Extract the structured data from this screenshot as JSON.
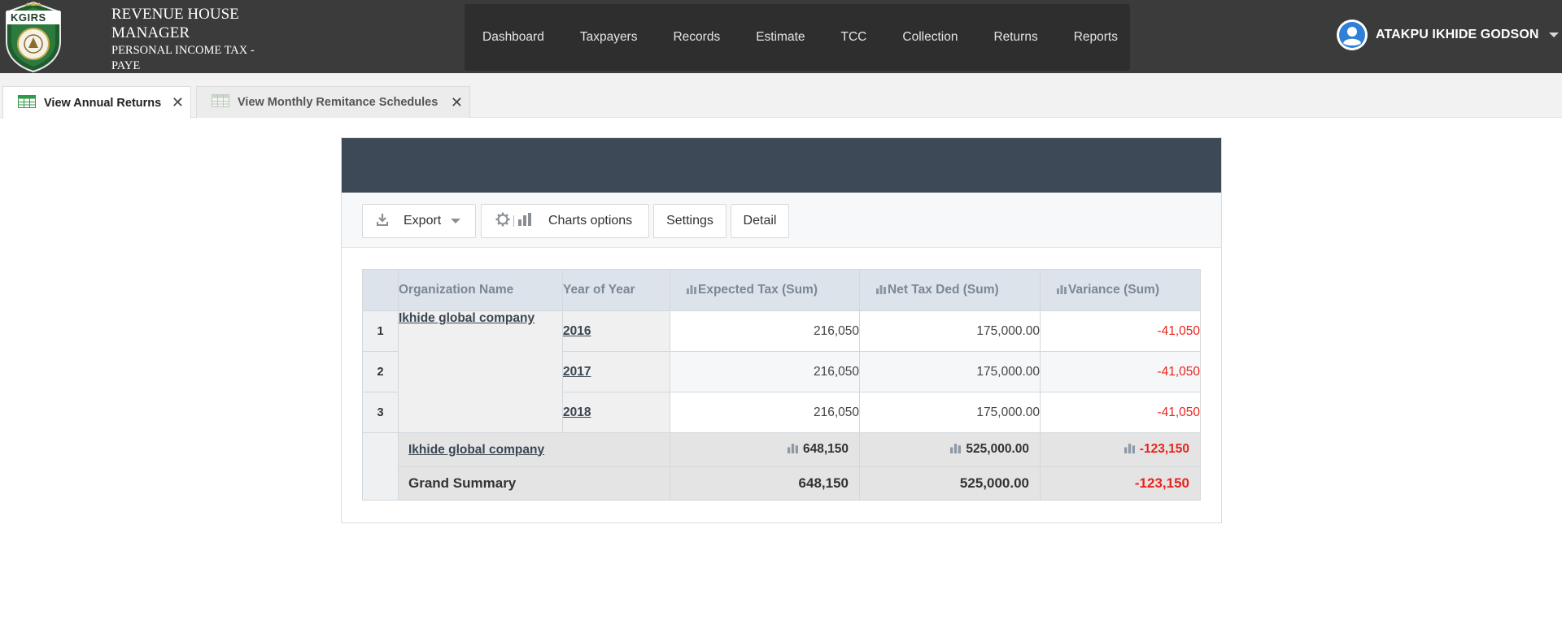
{
  "header": {
    "logo_text": "KGIRS",
    "title": "REVENUE HOUSE MANAGER",
    "subtitle": "PERSONAL INCOME TAX - PAYE",
    "nav": [
      "Dashboard",
      "Taxpayers",
      "Records",
      "Estimate",
      "TCC",
      "Collection",
      "Returns",
      "Reports"
    ],
    "user_name": "ATAKPU IKHIDE GODSON"
  },
  "tabs": [
    {
      "label": "View Annual Returns",
      "active": true
    },
    {
      "label": "View Monthly Remitance Schedules",
      "active": false
    }
  ],
  "toolbar": {
    "export_label": "Export",
    "charts_label": "Charts options",
    "settings_label": "Settings",
    "detail_label": "Detail"
  },
  "pivot": {
    "columns": [
      "Organization Name",
      "Year of Year",
      "Expected Tax (Sum)",
      "Net Tax Ded (Sum)",
      "Variance (Sum)"
    ],
    "rows": [
      {
        "num": "1",
        "year": "2016",
        "expected": "216,050",
        "net": "175,000.00",
        "variance": "-41,050"
      },
      {
        "num": "2",
        "year": "2017",
        "expected": "216,050",
        "net": "175,000.00",
        "variance": "-41,050"
      },
      {
        "num": "3",
        "year": "2018",
        "expected": "216,050",
        "net": "175,000.00",
        "variance": "-41,050"
      }
    ],
    "organization": "Ikhide global company",
    "subtotal": {
      "label": "Ikhide global company",
      "expected": "648,150",
      "net": "525,000.00",
      "variance": "-123,150"
    },
    "grand": {
      "label": "Grand Summary",
      "expected": "648,150",
      "net": "525,000.00",
      "variance": "-123,150"
    }
  },
  "colors": {
    "topbar": "#3b3b3b",
    "nav_bg": "#2e2e2e",
    "panel_header": "#3d4956",
    "negative": "#e8241c",
    "accent_green": "#2e9b47"
  }
}
